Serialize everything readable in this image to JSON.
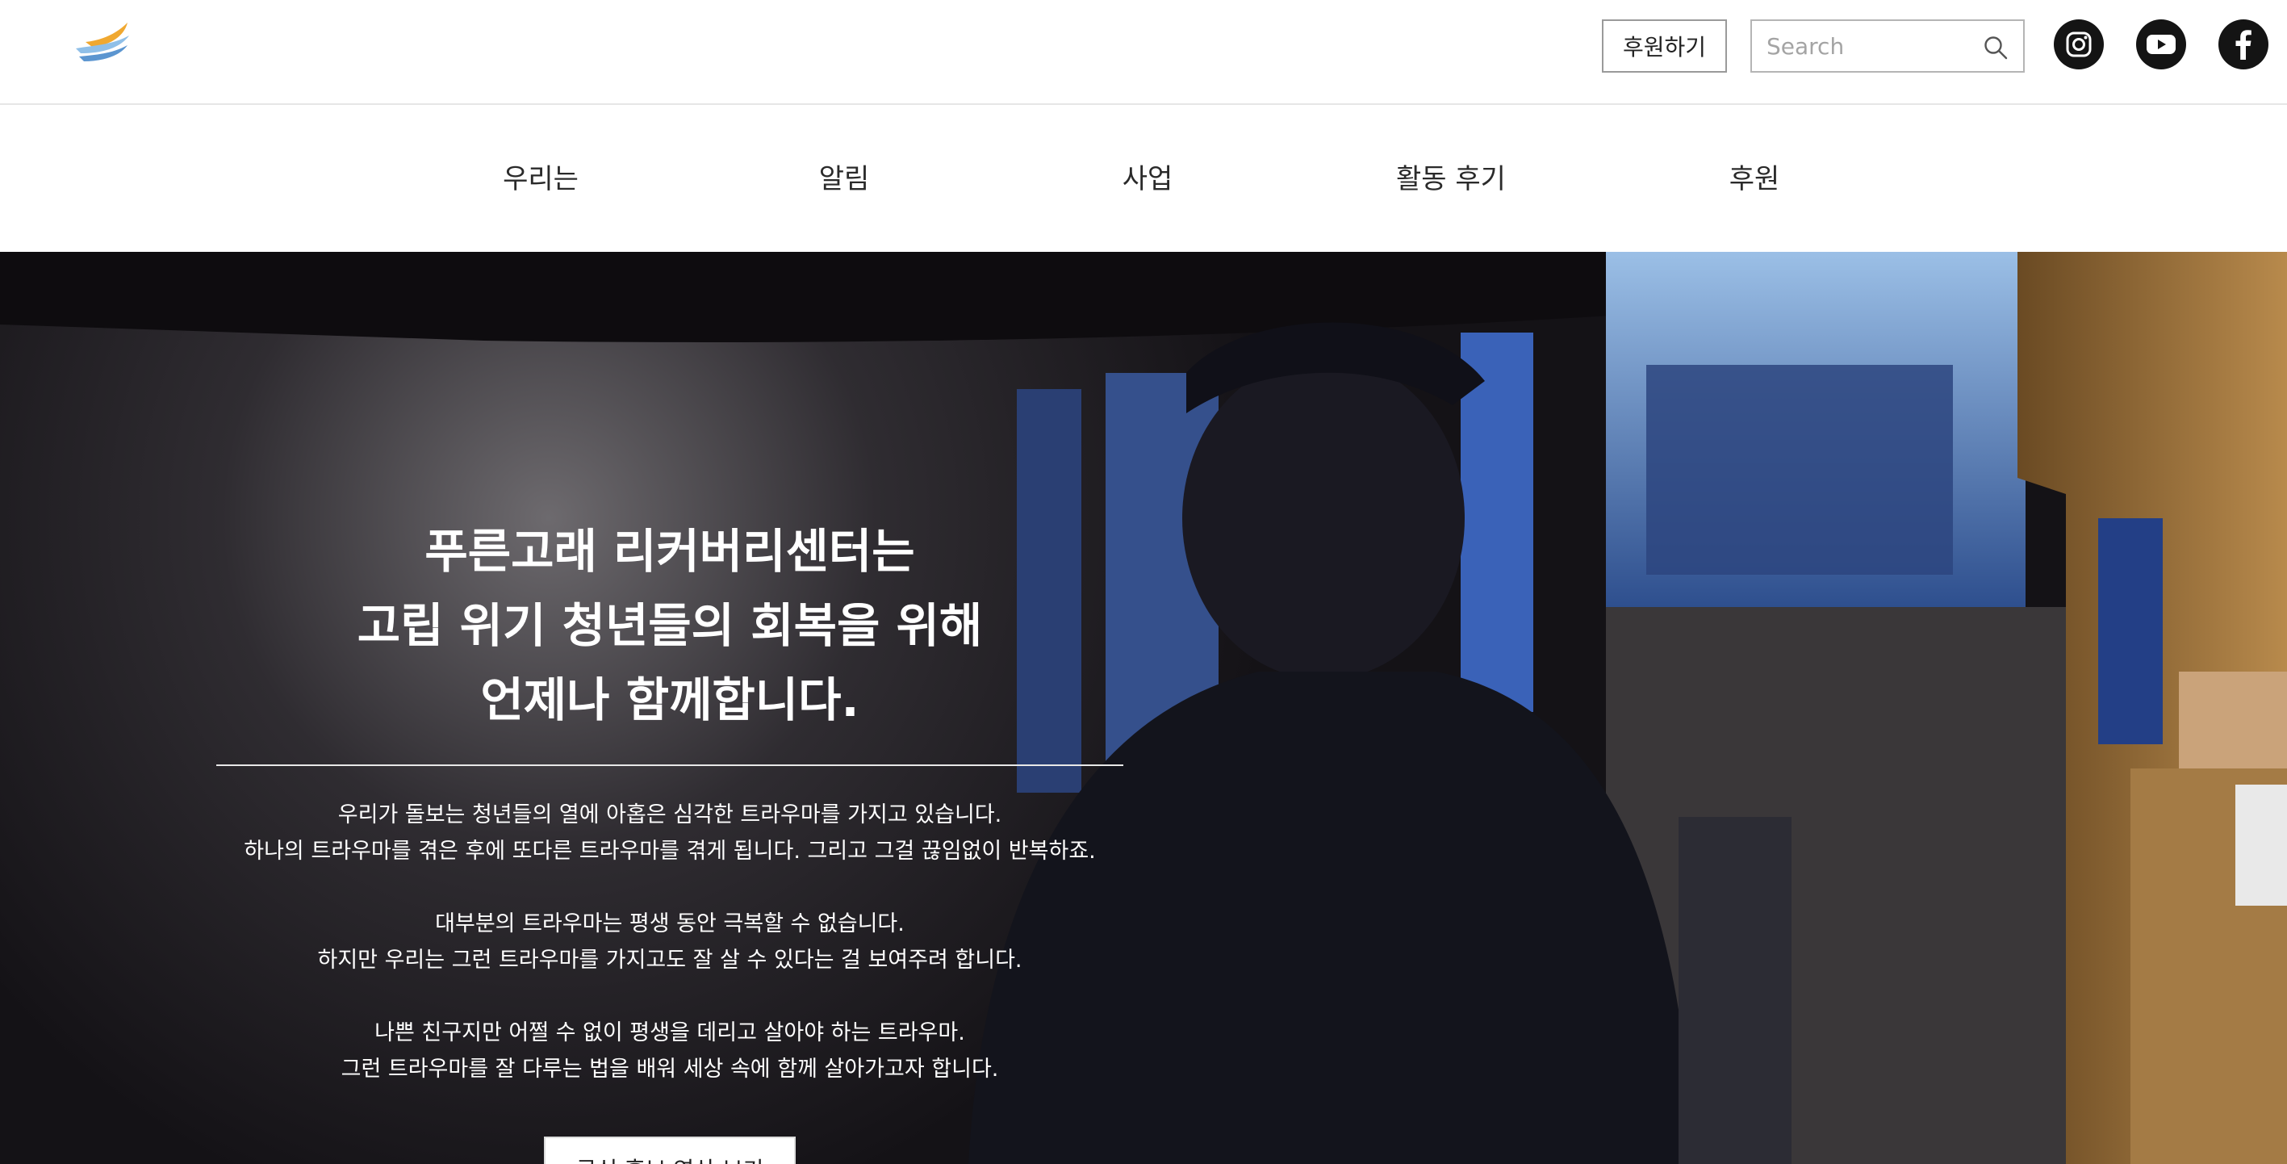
{
  "header": {
    "logo_icon": "blue-whale-wave-logo-icon",
    "donate_button_label": "후원하기",
    "search": {
      "placeholder": "Search",
      "value": "",
      "icon": "search-icon"
    },
    "social": [
      {
        "name": "instagram",
        "icon": "instagram-icon"
      },
      {
        "name": "youtube",
        "icon": "youtube-icon"
      },
      {
        "name": "facebook",
        "icon": "facebook-icon"
      }
    ]
  },
  "nav": {
    "items": [
      {
        "label": "우리는"
      },
      {
        "label": "알림"
      },
      {
        "label": "사업"
      },
      {
        "label": "활동 후기"
      },
      {
        "label": "후원"
      }
    ]
  },
  "hero": {
    "title_lines": [
      "푸른고래 리커버리센터는",
      "고립 위기 청년들의 회복을 위해",
      "언제나 함께합니다."
    ],
    "paragraphs": [
      [
        "우리가 돌보는 청년들의 열에 아홉은 심각한 트라우마를 가지고 있습니다.",
        "하나의 트라우마를 겪은 후에 또다른 트라우마를 겪게 됩니다. 그리고 그걸 끊임없이 반복하죠."
      ],
      [
        "대부분의 트라우마는 평생 동안 극복할 수 없습니다.",
        "하지만 우리는 그런 트라우마를 가지고도 잘 살 수 있다는 걸 보여주려 합니다."
      ],
      [
        "나쁜 친구지만 어쩔 수 없이 평생을 데리고 살아야 하는 트라우마.",
        "그런 트라우마를 잘 다루는 법을 배워 세상 속에 함께 살아가고자 합니다."
      ]
    ],
    "video_button_label": "공식 홍보 영상 보기"
  },
  "colors": {
    "icon_dark": "#141414",
    "logo_blue": "#6fa8dc",
    "logo_orange": "#f0a830",
    "hero_text": "#ffffff"
  }
}
